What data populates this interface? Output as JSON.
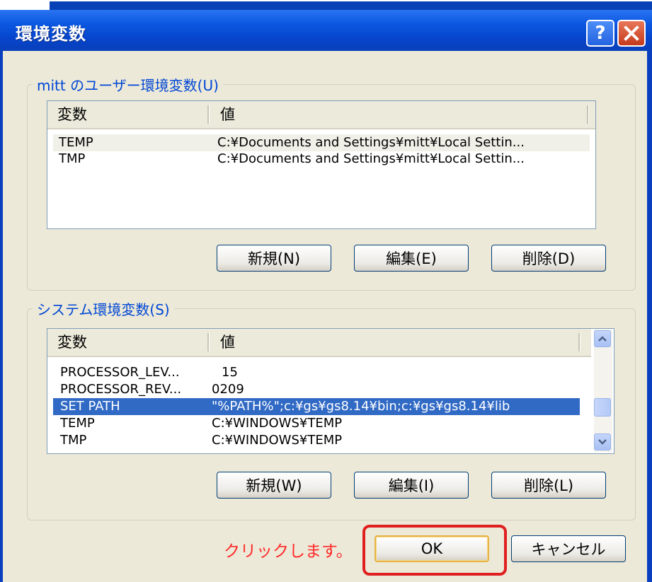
{
  "window": {
    "title": "環境変数"
  },
  "user_group": {
    "label": "mitt のユーザー環境変数(U)",
    "columns": [
      "変数",
      "値"
    ],
    "rows": [
      {
        "name": "TEMP",
        "value": "C:¥Documents and Settings¥mitt¥Local Settin..."
      },
      {
        "name": "TMP",
        "value": "C:¥Documents and Settings¥mitt¥Local Settin..."
      }
    ],
    "buttons": {
      "new": "新規(N)",
      "edit": "編集(E)",
      "delete": "削除(D)"
    }
  },
  "system_group": {
    "label": "システム環境変数(S)",
    "columns": [
      "変数",
      "値"
    ],
    "rows": [
      {
        "name": "PROCESSOR_LEV...",
        "value": "15"
      },
      {
        "name": "PROCESSOR_REV...",
        "value": "0209"
      },
      {
        "name": "SET PATH",
        "value": "\"%PATH%\";c:¥gs¥gs8.14¥bin;c:¥gs¥gs8.14¥lib"
      },
      {
        "name": "TEMP",
        "value": "C:¥WINDOWS¥TEMP"
      },
      {
        "name": "TMP",
        "value": "C:¥WINDOWS¥TEMP"
      }
    ],
    "buttons": {
      "new": "新規(W)",
      "edit": "編集(I)",
      "delete": "削除(L)"
    }
  },
  "footer": {
    "hint": "クリックします。",
    "ok": "OK",
    "cancel": "キャンセル"
  },
  "colors": {
    "title_bar": "#0b57e0",
    "selection": "#316ac5",
    "annotation": "#e02020"
  }
}
